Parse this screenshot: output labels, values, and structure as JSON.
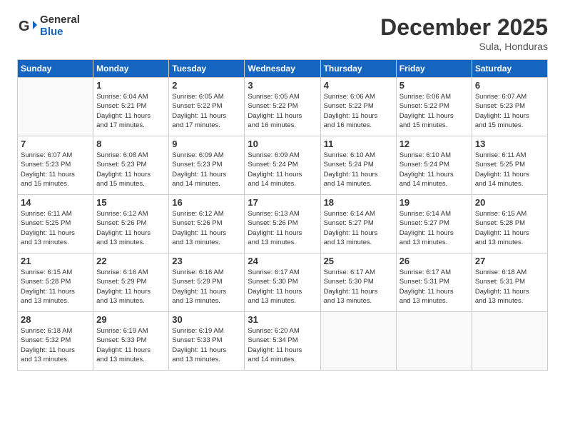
{
  "header": {
    "logo_general": "General",
    "logo_blue": "Blue",
    "month": "December 2025",
    "location": "Sula, Honduras"
  },
  "days_of_week": [
    "Sunday",
    "Monday",
    "Tuesday",
    "Wednesday",
    "Thursday",
    "Friday",
    "Saturday"
  ],
  "weeks": [
    [
      {
        "day": "",
        "info": ""
      },
      {
        "day": "1",
        "info": "Sunrise: 6:04 AM\nSunset: 5:21 PM\nDaylight: 11 hours\nand 17 minutes."
      },
      {
        "day": "2",
        "info": "Sunrise: 6:05 AM\nSunset: 5:22 PM\nDaylight: 11 hours\nand 17 minutes."
      },
      {
        "day": "3",
        "info": "Sunrise: 6:05 AM\nSunset: 5:22 PM\nDaylight: 11 hours\nand 16 minutes."
      },
      {
        "day": "4",
        "info": "Sunrise: 6:06 AM\nSunset: 5:22 PM\nDaylight: 11 hours\nand 16 minutes."
      },
      {
        "day": "5",
        "info": "Sunrise: 6:06 AM\nSunset: 5:22 PM\nDaylight: 11 hours\nand 15 minutes."
      },
      {
        "day": "6",
        "info": "Sunrise: 6:07 AM\nSunset: 5:23 PM\nDaylight: 11 hours\nand 15 minutes."
      }
    ],
    [
      {
        "day": "7",
        "info": "Sunrise: 6:07 AM\nSunset: 5:23 PM\nDaylight: 11 hours\nand 15 minutes."
      },
      {
        "day": "8",
        "info": "Sunrise: 6:08 AM\nSunset: 5:23 PM\nDaylight: 11 hours\nand 15 minutes."
      },
      {
        "day": "9",
        "info": "Sunrise: 6:09 AM\nSunset: 5:23 PM\nDaylight: 11 hours\nand 14 minutes."
      },
      {
        "day": "10",
        "info": "Sunrise: 6:09 AM\nSunset: 5:24 PM\nDaylight: 11 hours\nand 14 minutes."
      },
      {
        "day": "11",
        "info": "Sunrise: 6:10 AM\nSunset: 5:24 PM\nDaylight: 11 hours\nand 14 minutes."
      },
      {
        "day": "12",
        "info": "Sunrise: 6:10 AM\nSunset: 5:24 PM\nDaylight: 11 hours\nand 14 minutes."
      },
      {
        "day": "13",
        "info": "Sunrise: 6:11 AM\nSunset: 5:25 PM\nDaylight: 11 hours\nand 14 minutes."
      }
    ],
    [
      {
        "day": "14",
        "info": "Sunrise: 6:11 AM\nSunset: 5:25 PM\nDaylight: 11 hours\nand 13 minutes."
      },
      {
        "day": "15",
        "info": "Sunrise: 6:12 AM\nSunset: 5:26 PM\nDaylight: 11 hours\nand 13 minutes."
      },
      {
        "day": "16",
        "info": "Sunrise: 6:12 AM\nSunset: 5:26 PM\nDaylight: 11 hours\nand 13 minutes."
      },
      {
        "day": "17",
        "info": "Sunrise: 6:13 AM\nSunset: 5:26 PM\nDaylight: 11 hours\nand 13 minutes."
      },
      {
        "day": "18",
        "info": "Sunrise: 6:14 AM\nSunset: 5:27 PM\nDaylight: 11 hours\nand 13 minutes."
      },
      {
        "day": "19",
        "info": "Sunrise: 6:14 AM\nSunset: 5:27 PM\nDaylight: 11 hours\nand 13 minutes."
      },
      {
        "day": "20",
        "info": "Sunrise: 6:15 AM\nSunset: 5:28 PM\nDaylight: 11 hours\nand 13 minutes."
      }
    ],
    [
      {
        "day": "21",
        "info": "Sunrise: 6:15 AM\nSunset: 5:28 PM\nDaylight: 11 hours\nand 13 minutes."
      },
      {
        "day": "22",
        "info": "Sunrise: 6:16 AM\nSunset: 5:29 PM\nDaylight: 11 hours\nand 13 minutes."
      },
      {
        "day": "23",
        "info": "Sunrise: 6:16 AM\nSunset: 5:29 PM\nDaylight: 11 hours\nand 13 minutes."
      },
      {
        "day": "24",
        "info": "Sunrise: 6:17 AM\nSunset: 5:30 PM\nDaylight: 11 hours\nand 13 minutes."
      },
      {
        "day": "25",
        "info": "Sunrise: 6:17 AM\nSunset: 5:30 PM\nDaylight: 11 hours\nand 13 minutes."
      },
      {
        "day": "26",
        "info": "Sunrise: 6:17 AM\nSunset: 5:31 PM\nDaylight: 11 hours\nand 13 minutes."
      },
      {
        "day": "27",
        "info": "Sunrise: 6:18 AM\nSunset: 5:31 PM\nDaylight: 11 hours\nand 13 minutes."
      }
    ],
    [
      {
        "day": "28",
        "info": "Sunrise: 6:18 AM\nSunset: 5:32 PM\nDaylight: 11 hours\nand 13 minutes."
      },
      {
        "day": "29",
        "info": "Sunrise: 6:19 AM\nSunset: 5:33 PM\nDaylight: 11 hours\nand 13 minutes."
      },
      {
        "day": "30",
        "info": "Sunrise: 6:19 AM\nSunset: 5:33 PM\nDaylight: 11 hours\nand 13 minutes."
      },
      {
        "day": "31",
        "info": "Sunrise: 6:20 AM\nSunset: 5:34 PM\nDaylight: 11 hours\nand 14 minutes."
      },
      {
        "day": "",
        "info": ""
      },
      {
        "day": "",
        "info": ""
      },
      {
        "day": "",
        "info": ""
      }
    ]
  ]
}
